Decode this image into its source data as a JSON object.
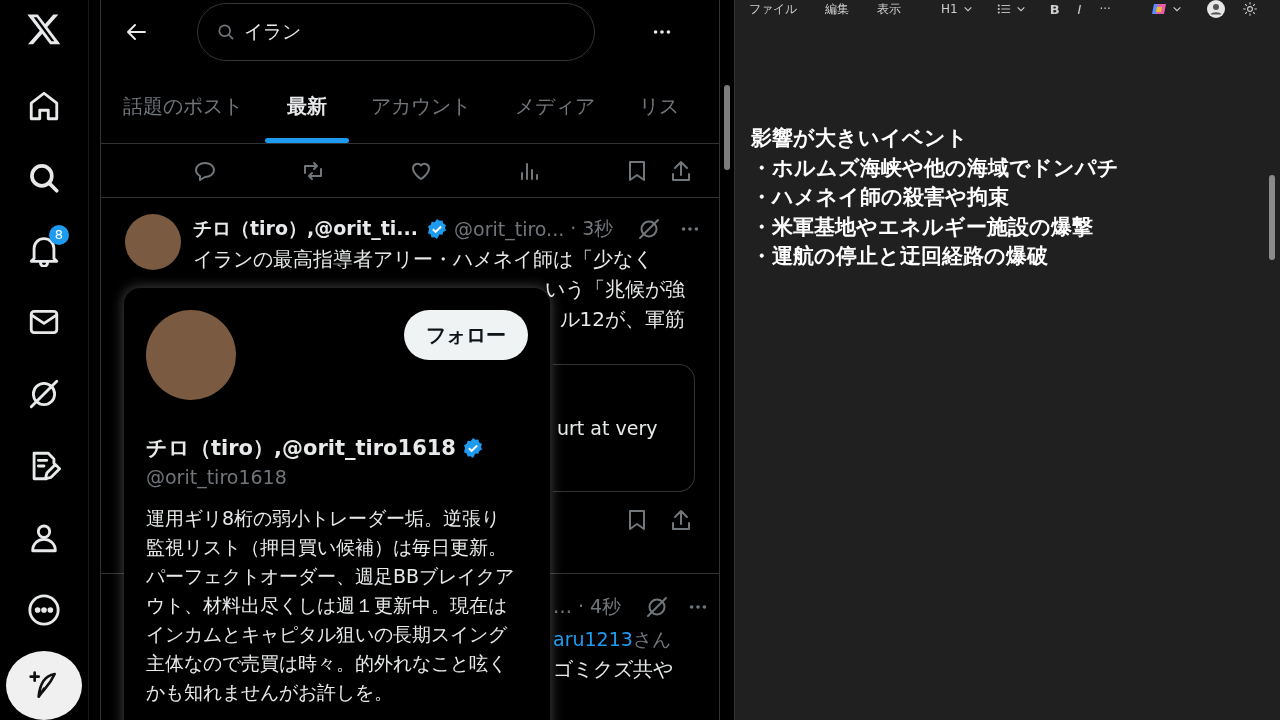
{
  "sidebar": {
    "items": [
      {
        "kind": "logo"
      },
      {
        "kind": "home"
      },
      {
        "kind": "search"
      },
      {
        "kind": "notifications",
        "badge": "8"
      },
      {
        "kind": "messages"
      },
      {
        "kind": "grok"
      },
      {
        "kind": "drafts"
      },
      {
        "kind": "profile"
      },
      {
        "kind": "more"
      },
      {
        "kind": "compose"
      }
    ]
  },
  "search": {
    "value": "イラン"
  },
  "tabs": [
    {
      "label": "話題のポスト",
      "selected": false
    },
    {
      "label": "最新",
      "selected": true
    },
    {
      "label": "アカウント",
      "selected": false
    },
    {
      "label": "メディア",
      "selected": false
    },
    {
      "label": "リス",
      "selected": false
    }
  ],
  "posts": [
    {
      "name": "チロ（tiro）,@orit_ti...",
      "verified": true,
      "handle": "@orit_tiro...",
      "time": "· 3秒",
      "lines": [
        "イランの最高指導者アリー・ハメネイ師は「少なく",
        "いう「兆候が強",
        "ル12が、軍筋"
      ],
      "card_text": "urt at very"
    },
    {
      "time": "… · 4秒",
      "mention": "aru1213",
      "mention_suffix": "さん",
      "line": "ゴミクズ共や"
    }
  ],
  "hover_card": {
    "name": "チロ（tiro）,@orit_tiro1618",
    "verified": true,
    "handle": "@orit_tiro1618",
    "follow": "フォロー",
    "bio": "運用ギリ8桁の弱小トレーダー垢。逆張り監視リスト（押目買い候補）は毎日更新。パーフェクトオーダー、週足BBブレイクアウト、材料出尽くしは週１更新中。現在はインカムとキャピタル狙いの長期スイング主体なので売買は時々。的外れなこと呟くかも知れませんがお許しを。"
  },
  "notepad": {
    "menu": [
      "ファイル",
      "編集",
      "表示"
    ],
    "heading": "H1",
    "bold": "B",
    "italic": "I",
    "more": "···",
    "title": "影響が大きいイベント",
    "lines": [
      "・ホルムズ海峡や他の海域でドンパチ",
      "・ハメネイ師の殺害や拘束",
      "・米軍基地やエネルギー施設の爆撃",
      "・運航の停止と迂回経路の爆破"
    ]
  }
}
